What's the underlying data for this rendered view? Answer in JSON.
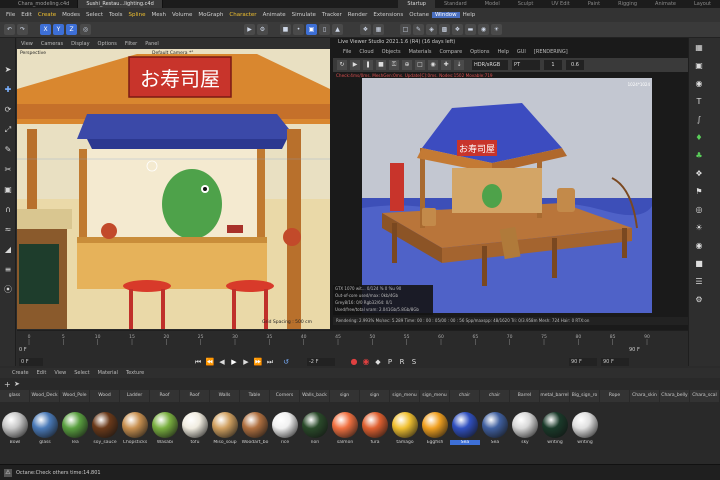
{
  "file_tabs": [
    "Chara_modeling.c4d",
    "Sushi_Restau...lighting.c4d",
    "Startup"
  ],
  "layouts": [
    "Standard",
    "Model",
    "Sculpt",
    "UV Edit",
    "Paint",
    "Rigging",
    "Animate",
    "Layout"
  ],
  "menu": [
    "File",
    "Edit",
    "Create",
    "Modes",
    "Select",
    "Tools",
    "Spline",
    "Mesh",
    "Volume",
    "MoGraph",
    "Character",
    "Animate",
    "Simulate",
    "Tracker",
    "Render",
    "Extensions",
    "Octane",
    "Window",
    "Help"
  ],
  "viewport": {
    "menu": [
      "View",
      "Cameras",
      "Display",
      "Options",
      "Filter",
      "Panel"
    ],
    "label": "Perspective",
    "camera": "Default Camera *°",
    "grid": "Grid Spacing : 500 cm",
    "sign": "お寿司屋"
  },
  "live_viewer": {
    "title": "Live Viewer Studio 2021.1.6 (R4) (16 days left)",
    "menu": [
      "File",
      "Cloud",
      "Objects",
      "Materials",
      "Compare",
      "Options",
      "Help",
      "GUI",
      "[RENDERING]"
    ],
    "color_mode": "HDR/sRGB",
    "mode": "PT",
    "value1": "1",
    "value2": "0.6",
    "status": "Check:4ms/0ms. MeshGen:0ms. Update[C]:0ms. Nodes:1502 Movable:719",
    "resolution": "1024*1024",
    "sign": "お寿司屋",
    "gpu_table": [
      "GTX 1070 wit... 0/124 % 0 %u 90",
      "Out-of-core used/max: 0kb/4Gb",
      "Grey8/16: 0/0 Rgb32/64: 0/1",
      "Used/free/total vram: 2.041Gb/5.8Gb/8Gb"
    ],
    "rendering": "Rendering: 2.993%  Ms/sec: 5.289  Time: 00 : 00 : 05/00 : 00 : 56  Spp/maxspp: 48/1620  Tri: 0/3.958m  Mesh: 724  Hair: 0  RTX:on"
  },
  "timeline": {
    "start": "0 F",
    "end": "90 F",
    "current_frame": "-2 F",
    "end_field": "90 F",
    "end_field2": "90 F",
    "ticks": [
      "0",
      "5",
      "10",
      "15",
      "20",
      "25",
      "30",
      "35",
      "40",
      "45",
      "50",
      "55",
      "60",
      "65",
      "70",
      "75",
      "80",
      "85",
      "90"
    ]
  },
  "materials": {
    "menu": [
      "Create",
      "Edit",
      "View",
      "Select",
      "Material",
      "Texture"
    ],
    "row1": [
      "glass",
      "Wood_Deck",
      "Wood_Pole",
      "Wood",
      "Ladder",
      "Roof",
      "Roof",
      "Walls",
      "Table",
      "Corners",
      "Walls_back",
      "sign",
      "sign",
      "sign_menu",
      "sign_menu",
      "chair",
      "chair",
      "Barrel",
      "metal_barrel",
      "Big_sign_ro",
      "Rope",
      "Chara_skin",
      "Chara_belly",
      "Chara_scal"
    ],
    "row2": [
      {
        "name": "Bowl",
        "color": "#c8c8c8"
      },
      {
        "name": "glass",
        "color": "#4a7ab8"
      },
      {
        "name": "Tea",
        "color": "#5aa040"
      },
      {
        "name": "soy_sauce",
        "color": "#6b3a1a"
      },
      {
        "name": "Chopsticks",
        "color": "#c89050"
      },
      {
        "name": "Wasabi",
        "color": "#7ab040"
      },
      {
        "name": "tofu",
        "color": "#f0ece0"
      },
      {
        "name": "Miso_soup",
        "color": "#d0a060"
      },
      {
        "name": "Woodart_bo",
        "color": "#b07040"
      },
      {
        "name": "rice",
        "color": "#f0f0f0"
      },
      {
        "name": "nori",
        "color": "#2a4a2a"
      },
      {
        "name": "salmon",
        "color": "#f07040"
      },
      {
        "name": "fura",
        "color": "#e06030"
      },
      {
        "name": "tamago",
        "color": "#f0c030"
      },
      {
        "name": "Eggfish",
        "color": "#f0a020"
      },
      {
        "name": "Sea",
        "color": "#3050c0"
      },
      {
        "name": "Sea",
        "color": "#4060a0"
      },
      {
        "name": "sky",
        "color": "#d8d8d8"
      },
      {
        "name": "writing",
        "color": "#1a3a2a"
      },
      {
        "name": "writing",
        "color": "#e0e0e0"
      }
    ]
  },
  "status": "Octane:Check others time:14.801",
  "colors": {
    "accent": "#3d6fd6",
    "menu_hl": "#f0c030"
  }
}
